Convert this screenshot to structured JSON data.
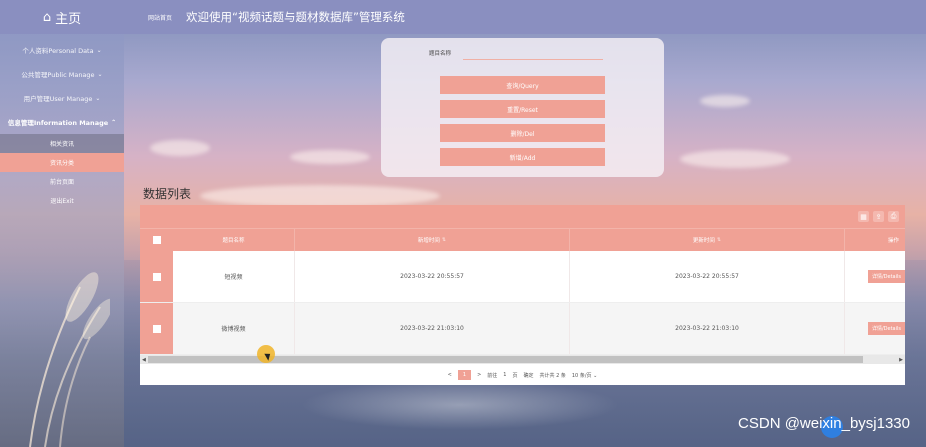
{
  "sidebar": {
    "home": "主页",
    "items": [
      {
        "label": "个人资料Personal Data",
        "open": false
      },
      {
        "label": "公共管理Public Manage",
        "open": false
      },
      {
        "label": "用户管理User Manage",
        "open": false
      },
      {
        "label": "信息管理Information Manage",
        "open": true
      }
    ],
    "sub_items": [
      {
        "label": "相关资讯",
        "state": "dark"
      },
      {
        "label": "资讯分类",
        "state": "active"
      },
      {
        "label": "前台页面",
        "state": ""
      },
      {
        "label": "退出Exit",
        "state": ""
      }
    ]
  },
  "header": {
    "breadcrumb": "网站首页",
    "title": "欢迎使用“视频话题与题材数据库”管理系统"
  },
  "search": {
    "field_label": "题目名称",
    "field_value": "",
    "buttons": [
      "查询/Query",
      "重置/Reset",
      "删除/Del",
      "新增/Add"
    ]
  },
  "section_title": "数据列表",
  "table": {
    "columns": [
      "题目名称",
      "新增时间",
      "更新时间",
      "操作"
    ],
    "rows": [
      {
        "name": "短视频",
        "create_time": "2023-03-22 20:55:57",
        "update_time": "2023-03-22 20:55:57",
        "action": "详情/Details"
      },
      {
        "name": "微博视频",
        "create_time": "2023-03-22 21:03:10",
        "update_time": "2023-03-22 21:03:10",
        "action": "详情/Details"
      }
    ]
  },
  "pager": {
    "prev": "<",
    "current": "1",
    "next": ">",
    "goto_label": "前往",
    "goto_value": "1",
    "page_unit": "页",
    "confirm": "确定",
    "total": "共计共 2 条",
    "page_size": "10 条/页"
  },
  "watermark": "CSDN @weixin_bysj1330",
  "colors": {
    "accent": "#f0a195",
    "header": "#8a8fc0"
  }
}
